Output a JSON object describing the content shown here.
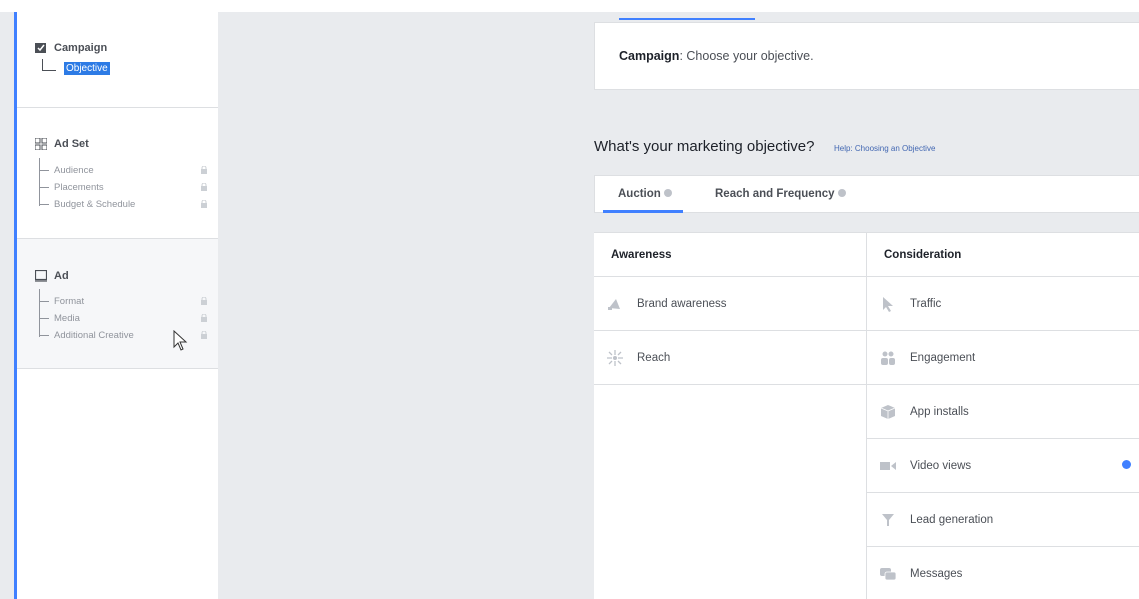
{
  "sidebar": {
    "campaign": {
      "title": "Campaign",
      "selected": "Objective"
    },
    "adset": {
      "title": "Ad Set",
      "items": [
        "Audience",
        "Placements",
        "Budget & Schedule"
      ]
    },
    "ad": {
      "title": "Ad",
      "items": [
        "Format",
        "Media",
        "Additional Creative"
      ]
    }
  },
  "main": {
    "campaign_label": "Campaign",
    "campaign_text": ": Choose your objective.",
    "question": "What's your marketing objective?",
    "help": "Help: Choosing an Objective",
    "tabs": [
      {
        "label": "Auction"
      },
      {
        "label": "Reach and Frequency"
      }
    ],
    "awareness": {
      "header": "Awareness",
      "items": [
        "Brand awareness",
        "Reach"
      ]
    },
    "consideration": {
      "header": "Consideration",
      "items": [
        "Traffic",
        "Engagement",
        "App installs",
        "Video views",
        "Lead generation",
        "Messages"
      ]
    }
  },
  "colors": {
    "accent": "#4080ff",
    "highlight": "#2d7be5",
    "icon": "#bec2c9"
  },
  "icons": {
    "brand_awareness": "megaphone-icon",
    "reach": "reach-burst-icon",
    "traffic": "cursor-pointer-icon",
    "engagement": "people-icon",
    "app_installs": "box-icon",
    "video_views": "video-camera-icon",
    "lead_generation": "funnel-icon",
    "messages": "chat-bubble-icon"
  }
}
